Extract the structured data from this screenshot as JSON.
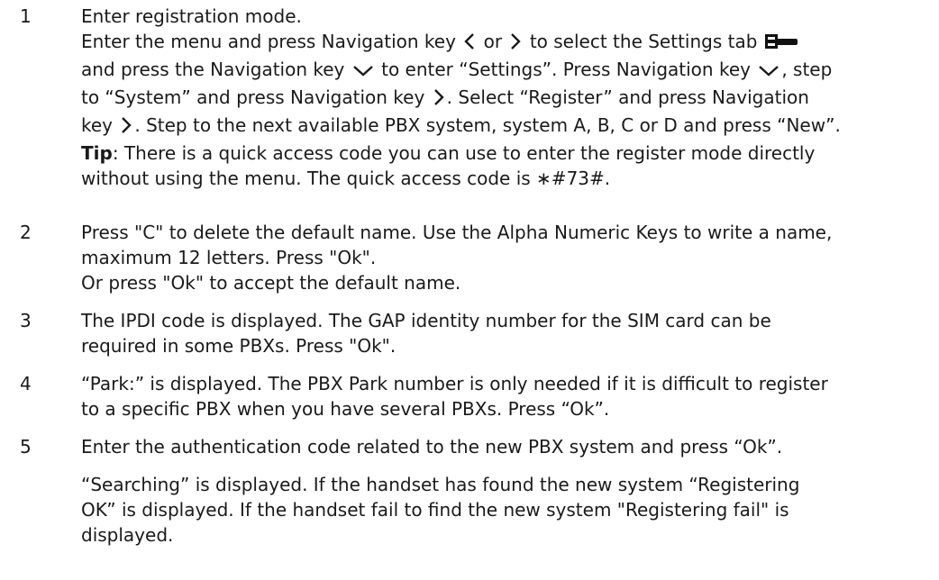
{
  "steps": [
    {
      "number": "1",
      "lines": {
        "l1": "Enter registration mode.",
        "l2a": "Enter the menu and press Navigation key",
        "l2b": "or",
        "l2c": "to select the Settings tab",
        "l3a": "and press the Navigation key",
        "l3b": "to enter “Settings”. Press Navigation key",
        "l3c": ", step",
        "l4a": "to “System” and press Navigation key",
        "l4b": ". Select “Register” and press Navigation",
        "l5a": "key",
        "l5b": ". Step to the next available PBX system, system A, B, C or D and press “New”.",
        "l6_bold": "Tip",
        "l6_rest": ": There is a quick access code you can use to enter the register mode directly",
        "l7": "without using the menu. The quick access code is ∗#73#."
      }
    },
    {
      "number": "2",
      "lines": {
        "l1": "Press \"C\" to delete the default name. Use the Alpha Numeric Keys to write a name,",
        "l2": "maximum 12 letters. Press \"Ok\".",
        "l3": "Or press \"Ok\" to accept the default name."
      }
    },
    {
      "number": "3",
      "lines": {
        "l1": "The IPDI code is displayed. The GAP identity number for the SIM card can be",
        "l2": "required in some PBXs. Press \"Ok\"."
      }
    },
    {
      "number": "4",
      "lines": {
        "l1": "“Park:” is displayed. The PBX Park number is only needed if it is difficult to register",
        "l2": "to a specific PBX when you have several PBXs. Press “Ok”."
      }
    },
    {
      "number": "5",
      "lines": {
        "l1": "Enter the authentication code related to the new PBX system and press “Ok”.",
        "p2l1": "“Searching” is displayed. If the handset has found the new system “Registering",
        "p2l2": "OK” is displayed. If the handset fail to find the new system \"Registering fail\" is",
        "p2l3": "displayed."
      }
    }
  ],
  "icons": {
    "nav_left": "chevron-left-icon",
    "nav_right": "chevron-right-icon",
    "nav_down": "chevron-down-icon",
    "settings_tab": "wrench-icon"
  }
}
